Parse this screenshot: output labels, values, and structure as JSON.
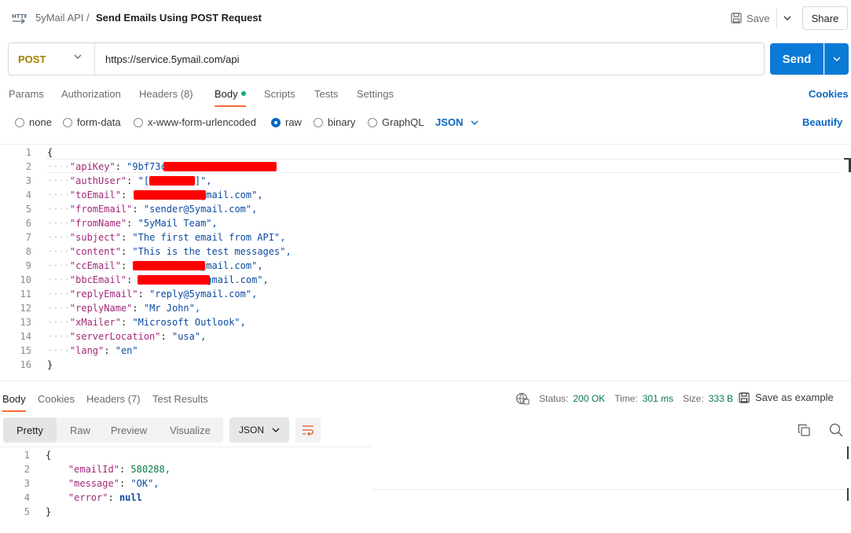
{
  "header": {
    "collection": "5yMail API",
    "separator": "/",
    "request_name": "Send Emails Using POST Request",
    "save_label": "Save",
    "share_label": "Share"
  },
  "request": {
    "method": "POST",
    "url": "https://service.5ymail.com/api",
    "send_label": "Send"
  },
  "request_tabs": [
    "Params",
    "Authorization",
    "Headers (8)",
    "Body",
    "Scripts",
    "Tests",
    "Settings"
  ],
  "active_request_tab": "Body",
  "cookies_label": "Cookies",
  "body_types": {
    "options": [
      "none",
      "form-data",
      "x-www-form-urlencoded",
      "raw",
      "binary",
      "GraphQL"
    ],
    "selected": "raw",
    "format": "JSON",
    "beautify_label": "Beautify"
  },
  "request_body_lines": [
    {
      "n": "1",
      "text": "{"
    },
    {
      "n": "2",
      "key": "\"apiKey\"",
      "value": "\"9bf73c[redacted]5142d76\","
    },
    {
      "n": "3",
      "key": "\"authUser\"",
      "value": "\"[redacted]\","
    },
    {
      "n": "4",
      "key": "\"toEmail\"",
      "value": "\"[redacted]@gmail.com\","
    },
    {
      "n": "5",
      "key": "\"fromEmail\"",
      "value": "\"sender@5ymail.com\","
    },
    {
      "n": "6",
      "key": "\"fromName\"",
      "value": "\"5yMail Team\","
    },
    {
      "n": "7",
      "key": "\"subject\"",
      "value": "\"The first email from API\","
    },
    {
      "n": "8",
      "key": "\"content\"",
      "value": "\"This is the test messages\","
    },
    {
      "n": "9",
      "key": "\"ccEmail\"",
      "value": "\"[redacted]@gmail.com\","
    },
    {
      "n": "10",
      "key": "\"bbcEmail\"",
      "value": "\"[redacted]@gmail.com\","
    },
    {
      "n": "11",
      "key": "\"replyEmail\"",
      "value": "\"reply@5ymail.com\","
    },
    {
      "n": "12",
      "key": "\"replyName\"",
      "value": "\"Mr John\","
    },
    {
      "n": "13",
      "key": "\"xMailer\"",
      "value": "\"Microsoft Outlook\","
    },
    {
      "n": "14",
      "key": "\"serverLocation\"",
      "value": "\"usa\","
    },
    {
      "n": "15",
      "key": "\"lang\"",
      "value": "\"en\""
    },
    {
      "n": "16",
      "text": "}"
    }
  ],
  "response_tabs": [
    "Body",
    "Cookies",
    "Headers (7)",
    "Test Results"
  ],
  "active_response_tab": "Body",
  "response_status": {
    "status_label": "Status:",
    "status_value": "200 OK",
    "time_label": "Time:",
    "time_value": "301 ms",
    "size_label": "Size:",
    "size_value": "333 B",
    "save_example_label": "Save as example"
  },
  "response_views": [
    "Pretty",
    "Raw",
    "Preview",
    "Visualize"
  ],
  "active_response_view": "Pretty",
  "response_format": "JSON",
  "response_body_lines": [
    {
      "n": "1",
      "text": "{"
    },
    {
      "n": "2",
      "key": "\"emailId\"",
      "value": "580288,"
    },
    {
      "n": "3",
      "key": "\"message\"",
      "value": "\"OK\","
    },
    {
      "n": "4",
      "key": "\"error\"",
      "value": "null"
    },
    {
      "n": "5",
      "text": "}"
    }
  ],
  "colors": {
    "accent_blue": "#0b7ad6",
    "link_blue": "#0b67c2",
    "method_post": "#a68000",
    "active_tab_underline": "#ff6c37",
    "status_ok": "#0a7a4a",
    "redaction": "#ff0000"
  }
}
